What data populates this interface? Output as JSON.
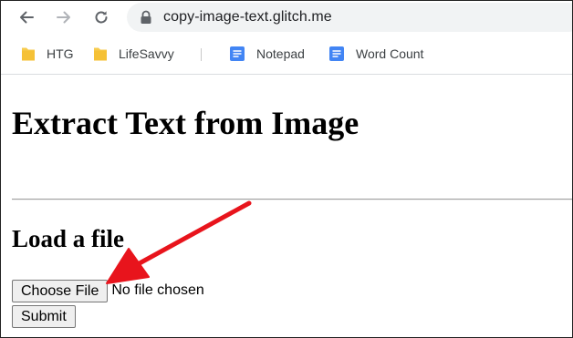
{
  "browser": {
    "url": "copy-image-text.glitch.me",
    "bookmarks": [
      {
        "label": "HTG",
        "icon": "folder-icon"
      },
      {
        "label": "LifeSavvy",
        "icon": "folder-icon"
      },
      {
        "label": "Notepad",
        "icon": "document-icon"
      },
      {
        "label": "Word Count",
        "icon": "document-icon"
      }
    ]
  },
  "page": {
    "title": "Extract Text from Image",
    "section_title": "Load a file",
    "choose_file_label": "Choose File",
    "no_file_text": "No file chosen",
    "submit_label": "Submit"
  },
  "annotation": {
    "arrow_color": "#e8141c",
    "arrow_target": "choose-file-button"
  },
  "colors": {
    "folder": "#f7cb4d",
    "document": "#4285f4",
    "omnibox": "#f1f3f4"
  }
}
